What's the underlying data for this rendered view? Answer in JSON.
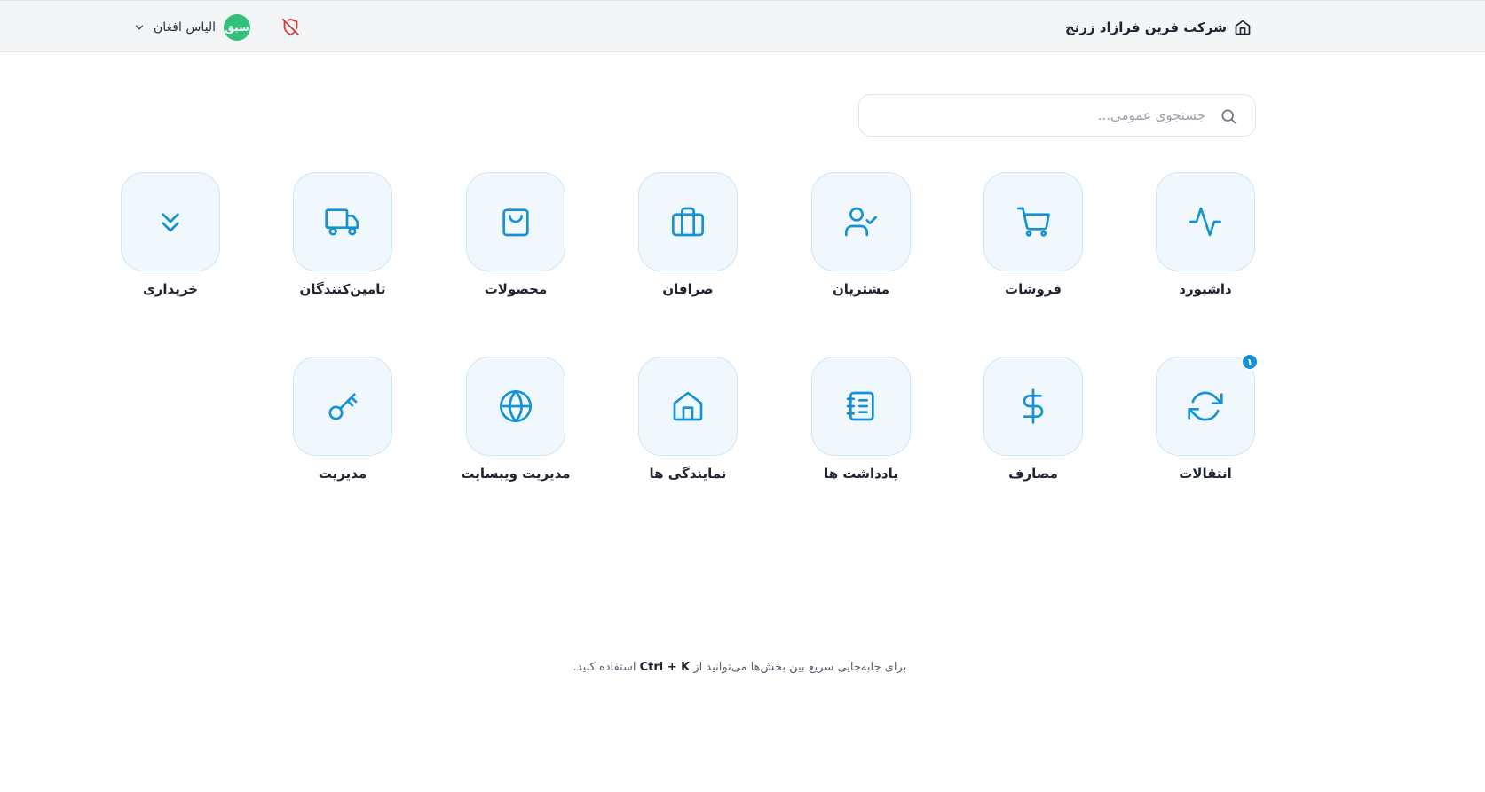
{
  "header": {
    "company_name": "شرکت فرین فرازاد زرنج",
    "user_name": "الیاس افغان",
    "avatar_initials": "سبق",
    "avatar_color": "#33c07a"
  },
  "search": {
    "placeholder": "جستجوی عمومی..."
  },
  "accent_color": "#1592d4",
  "modules_row1": [
    {
      "label": "داشبورد",
      "icon": "activity-icon"
    },
    {
      "label": "فروشات",
      "icon": "cart-icon"
    },
    {
      "label": "مشتریان",
      "icon": "user-check-icon"
    },
    {
      "label": "صرافان",
      "icon": "briefcase-icon"
    },
    {
      "label": "محصولات",
      "icon": "shopping-bag-icon"
    },
    {
      "label": "تامین‌کنندگان",
      "icon": "truck-icon"
    },
    {
      "label": "خریداری",
      "icon": "chevrons-down-icon"
    }
  ],
  "modules_row2": [
    {
      "label": "انتقالات",
      "icon": "refresh-icon",
      "badge": "۱"
    },
    {
      "label": "مصارف",
      "icon": "dollar-icon"
    },
    {
      "label": "یادداشت ها",
      "icon": "notebook-icon"
    },
    {
      "label": "نمایندگی ها",
      "icon": "home-icon"
    },
    {
      "label": "مدیریت ویبسایت",
      "icon": "globe-icon"
    },
    {
      "label": "مدیریت",
      "icon": "key-icon"
    }
  ],
  "footer": {
    "before": "برای جابه‌جایی سریع بین بخش‌ها می‌توانید از",
    "shortcut": "Ctrl + K",
    "after": "استفاده کنید."
  }
}
